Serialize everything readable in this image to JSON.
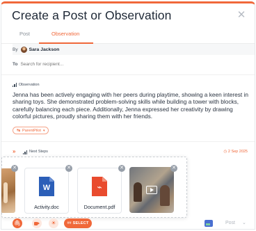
{
  "dialog": {
    "title": "Create a Post or Observation",
    "close_icon": "close-icon",
    "accent": "#f0683a"
  },
  "tabs": [
    {
      "label": "Post",
      "active": false
    },
    {
      "label": "Observation",
      "active": true
    }
  ],
  "author": {
    "by_label": "By",
    "name": "Sara Jackson"
  },
  "recipient": {
    "to_label": "To",
    "placeholder": "Search for recipient..."
  },
  "observation": {
    "section_label": "Observation",
    "section_icon": "bar-chart-icon",
    "text": "Jenna has been actively engaging with her peers during playtime, showing a keen interest in sharing toys. She demonstrated problem-solving skills while building a tower with blocks, carefully balancing each piece. Additionally, Jenna expressed her creativity by drawing colorful pictures, proudly sharing them with her friends.",
    "parentpilot_label": "ParentPilot"
  },
  "next_steps": {
    "label": "Next Steps",
    "date": "2 Sep 2025"
  },
  "attachments": [
    {
      "type": "photo",
      "name": ""
    },
    {
      "type": "word",
      "name": "Activity.doc"
    },
    {
      "type": "pdf",
      "name": "Document.pdf"
    },
    {
      "type": "video",
      "name": ""
    }
  ],
  "footer": {
    "select_tag": "##",
    "select_label": "SELECT",
    "post_label": "Post"
  }
}
